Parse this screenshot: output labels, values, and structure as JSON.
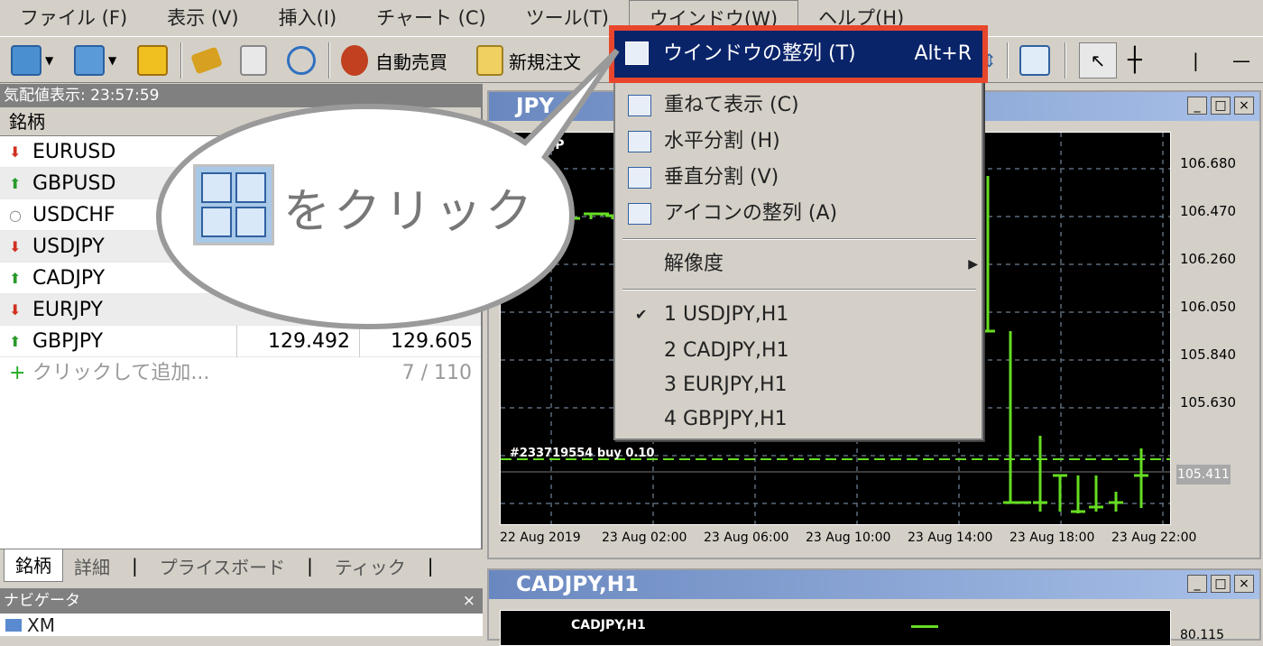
{
  "menubar": {
    "items": [
      "ファイル (F)",
      "表示 (V)",
      "挿入(I)",
      "チャート (C)",
      "ツール(T)",
      "ウインドウ(W)",
      "ヘルプ(H)"
    ]
  },
  "toolbar": {
    "auto_trade": "自動売買",
    "new_order": "新規注文"
  },
  "market_watch": {
    "title": "気配値表示: 23:57:59",
    "column_symbol": "銘柄",
    "rows": [
      {
        "symbol": "EURUSD",
        "dir": "down",
        "bid": "",
        "ask": ""
      },
      {
        "symbol": "GBPUSD",
        "dir": "up",
        "bid": "",
        "ask": ""
      },
      {
        "symbol": "USDCHF",
        "dir": "none",
        "bid": "",
        "ask": ""
      },
      {
        "symbol": "USDJPY",
        "dir": "down",
        "bid": "",
        "ask": ""
      },
      {
        "symbol": "CADJPY",
        "dir": "up",
        "bid": "",
        "ask": ""
      },
      {
        "symbol": "EURJPY",
        "dir": "down",
        "bid": "",
        "ask": ""
      },
      {
        "symbol": "GBPJPY",
        "dir": "up",
        "bid": "129.492",
        "ask": "129.605"
      }
    ],
    "add_label": "クリックして追加...",
    "count": "7 / 110",
    "tabs": [
      "銘柄",
      "詳細",
      "プライスボード",
      "ティック"
    ]
  },
  "navigator": {
    "title": "ナビゲータ",
    "close": "×",
    "item": "XM"
  },
  "callout": {
    "text": "をクリック"
  },
  "window_menu": {
    "highlighted": {
      "label": "ウインドウの整列 (T)",
      "shortcut": "Alt+R"
    },
    "items": [
      "重ねて表示 (C)",
      "水平分割 (H)",
      "垂直分割 (V)",
      "アイコンの整列 (A)"
    ],
    "resolution": "解像度",
    "windows": [
      "1 USDJPY,H1",
      "2 CADJPY,H1",
      "3 EURJPY,H1",
      "4 GBPJPY,H1"
    ]
  },
  "chart_top": {
    "title": "USDJPY,H1",
    "title_visible": "JPY",
    "inner_label": "USDJP",
    "order_label": "#233719554 buy 0.10",
    "current_price": "105.411",
    "y_ticks": [
      "106.680",
      "106.470",
      "106.260",
      "106.050",
      "105.840",
      "105.630"
    ],
    "x_ticks": [
      "22 Aug 2019",
      "23 Aug 02:00",
      "23 Aug 06:00",
      "23 Aug 10:00",
      "23 Aug 14:00",
      "23 Aug 18:00",
      "23 Aug 22:00"
    ]
  },
  "chart_bottom": {
    "title": "CADJPY,H1",
    "inner_label": "CADJPY,H1",
    "y_tick": "80.115"
  },
  "colors": {
    "accent_red": "#e8462c",
    "menu_highlight": "#0a246a",
    "candle_green": "#66dd22"
  }
}
